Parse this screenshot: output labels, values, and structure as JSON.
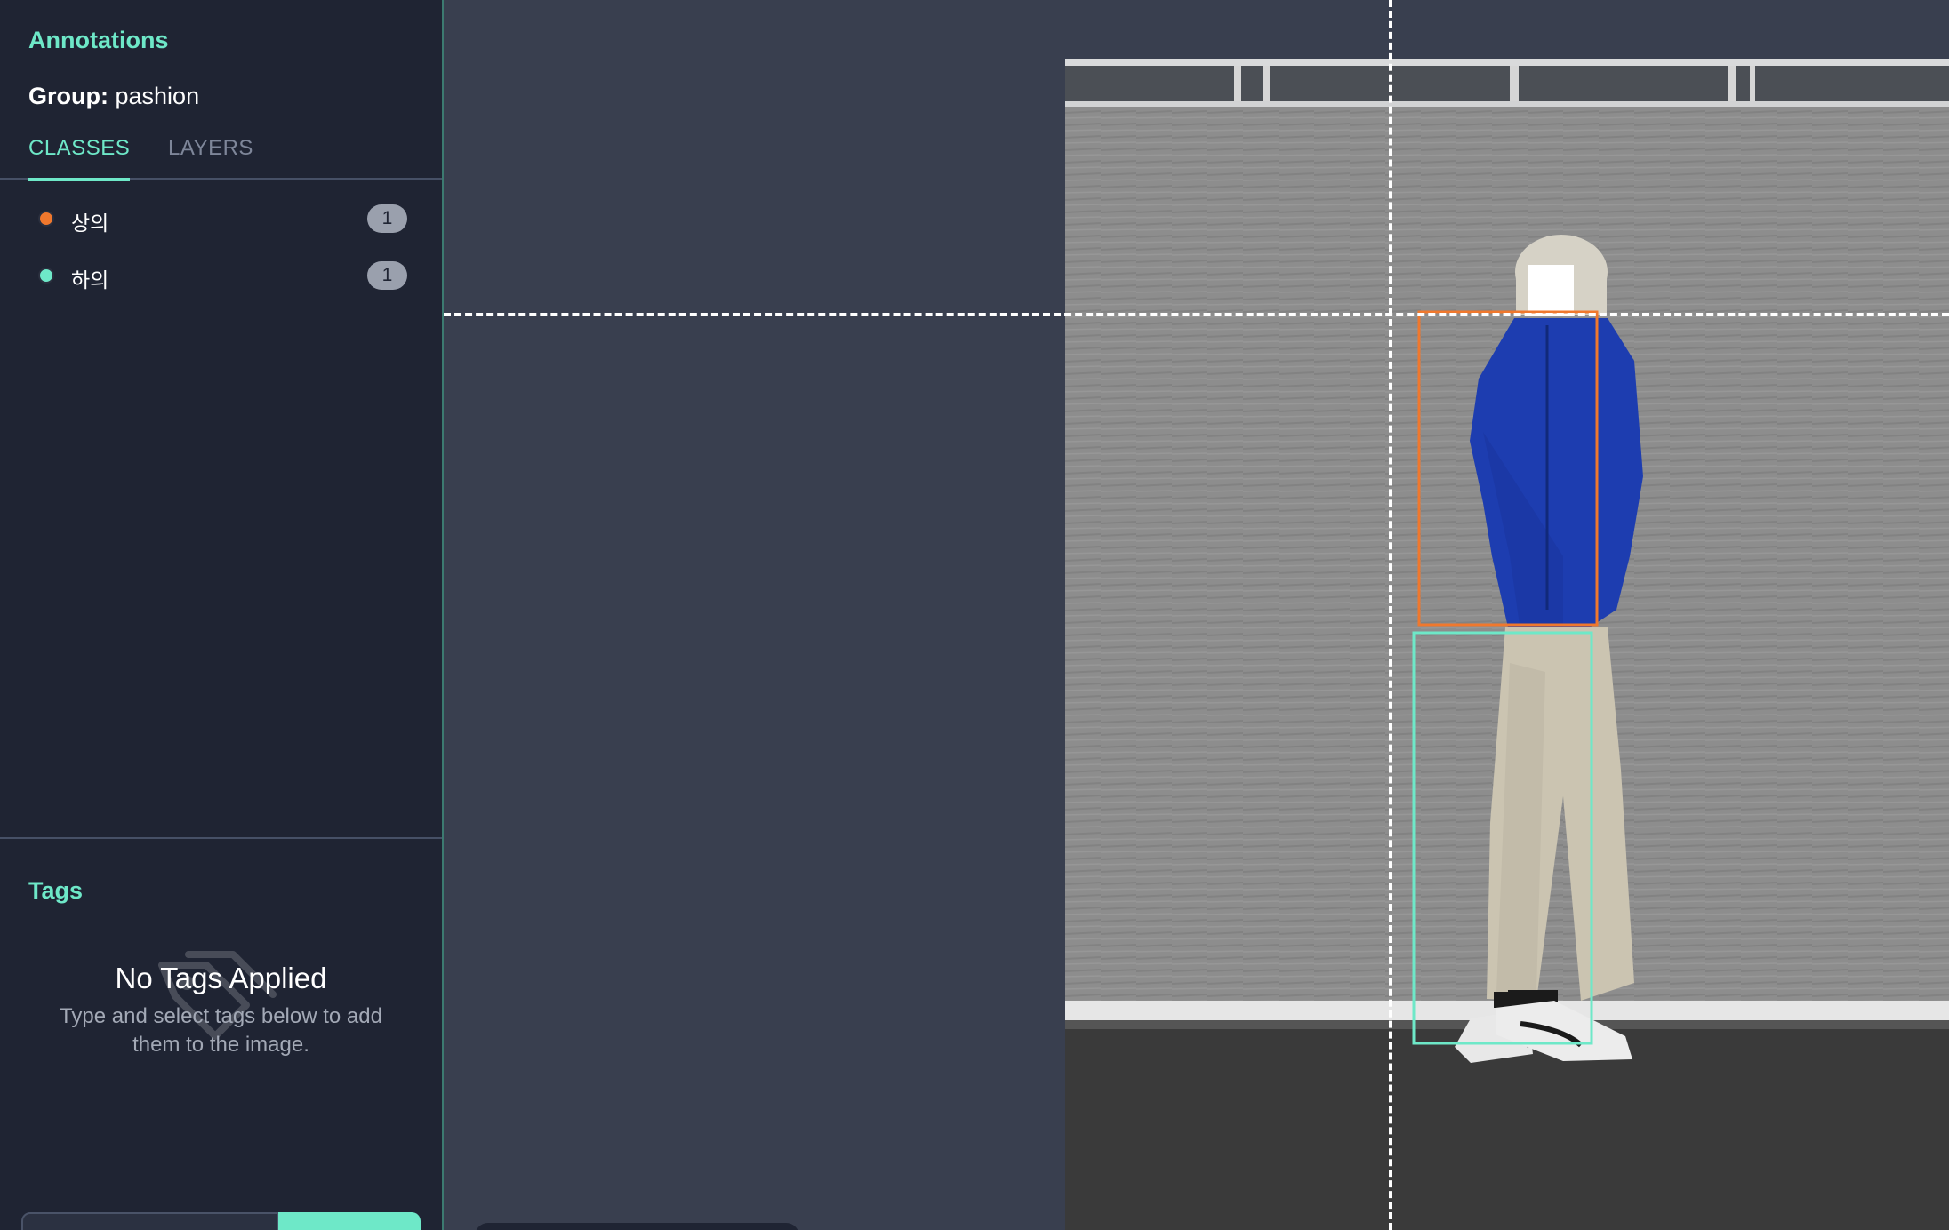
{
  "sidebar": {
    "annotations_title": "Annotations",
    "group_label": "Group:",
    "group_name": "pashion",
    "tabs": [
      {
        "label": "CLASSES",
        "active": true
      },
      {
        "label": "LAYERS",
        "active": false
      }
    ],
    "classes": [
      {
        "label": "상의",
        "count": "1",
        "color": "#f0782d"
      },
      {
        "label": "하의",
        "count": "1",
        "color": "#6ee8c8"
      }
    ],
    "tags_title": "Tags",
    "empty_tags_title": "No Tags Applied",
    "empty_tags_desc": "Type and select tags below to add them to the image."
  },
  "annotations": [
    {
      "class": "상의",
      "color": "#f0782d"
    },
    {
      "class": "하의",
      "color": "#6ee8c8"
    }
  ],
  "colors": {
    "accent": "#6ee8c8",
    "sidebar_bg": "#1f2433",
    "canvas_bg": "#393f4f"
  }
}
